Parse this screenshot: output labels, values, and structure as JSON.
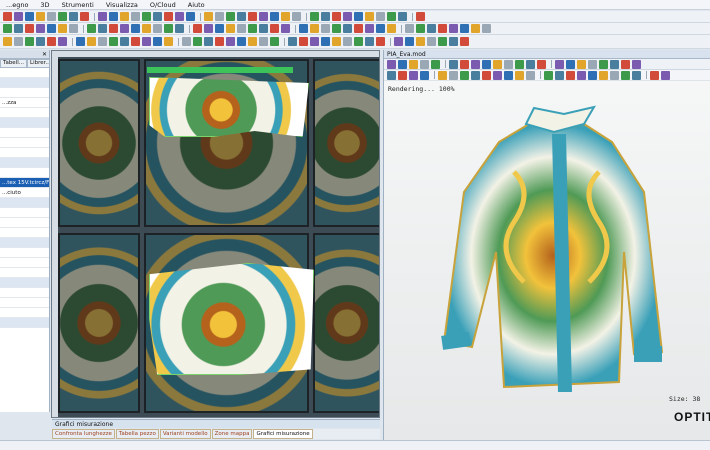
{
  "menu": [
    "...egno",
    "3D",
    "Strumenti",
    "Visualizza",
    "O/Cloud",
    "Aiuto"
  ],
  "left_panel": {
    "tabs": [
      "Tabell...",
      "Librer..."
    ],
    "rows": [
      "",
      "",
      "",
      "...zza",
      "",
      "",
      "",
      "",
      "",
      "",
      "",
      "...tex 15V.tcircz/F-c",
      "...ciuto",
      "",
      "",
      "",
      "",
      "",
      "",
      "",
      "",
      "",
      "",
      "",
      "",
      ""
    ]
  },
  "bottom_tabs": {
    "title": "Grafici misurazione",
    "items": [
      "Confronta lunghezze",
      "Tabella pezzo",
      "Varianti modello",
      "Zone mappa",
      "Grafici misurazione"
    ]
  },
  "viewer": {
    "title": "PIA_Eva.mod",
    "rendering_text": "Rendering... 100%",
    "size_text": "Size: 38",
    "brand": "OPTIT"
  },
  "colors": {
    "accent_blue": "#1a5fb4",
    "selection_green": "#3cc45a",
    "shirt_teal": "#3aa0b8",
    "shirt_gold": "#f0c84a"
  }
}
